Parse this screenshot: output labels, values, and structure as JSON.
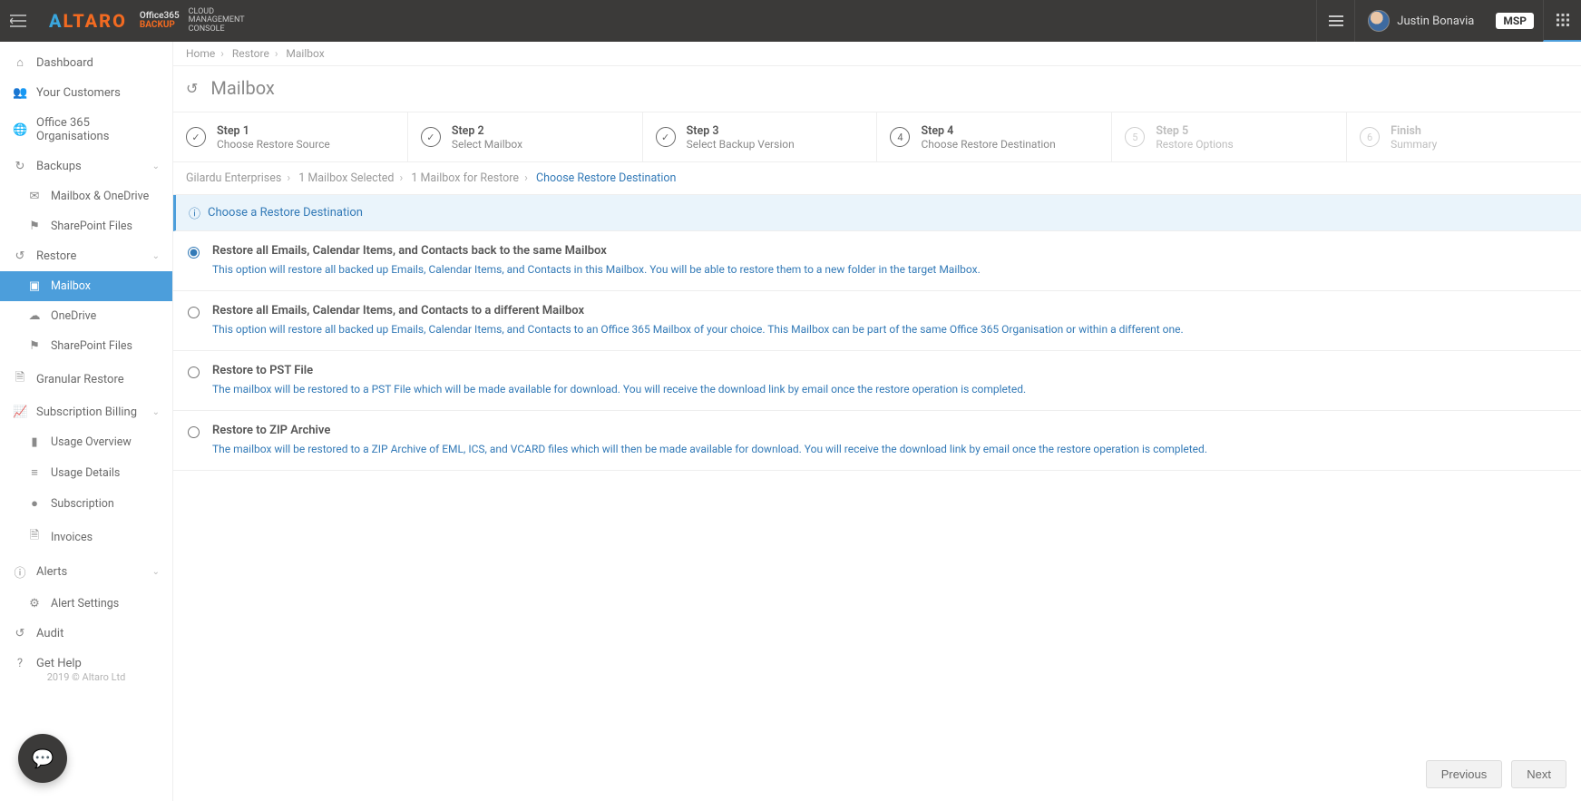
{
  "header": {
    "brand_primary": "ALTARO",
    "brand_office": "Office365",
    "brand_backup": "BACKUP",
    "brand_tag1": "CLOUD",
    "brand_tag2": "MANAGEMENT",
    "brand_tag3": "CONSOLE",
    "user_name": "Justin Bonavia",
    "msp_label": "MSP"
  },
  "sidebar": {
    "items": {
      "dashboard": "Dashboard",
      "your_customers": "Your Customers",
      "office365": "Office 365 Organisations",
      "backups": "Backups",
      "backups_mailbox": "Mailbox & OneDrive",
      "backups_sharepoint": "SharePoint Files",
      "restore": "Restore",
      "restore_mailbox": "Mailbox",
      "restore_onedrive": "OneDrive",
      "restore_sharepoint": "SharePoint Files",
      "granular_restore": "Granular Restore",
      "billing": "Subscription Billing",
      "billing_overview": "Usage Overview",
      "billing_details": "Usage Details",
      "billing_subscription": "Subscription",
      "billing_invoices": "Invoices",
      "alerts": "Alerts",
      "alert_settings": "Alert Settings",
      "audit": "Audit",
      "get_help": "Get Help"
    },
    "footer": "2019  © Altaro Ltd"
  },
  "breadcrumbs": {
    "home": "Home",
    "restore": "Restore",
    "mailbox": "Mailbox"
  },
  "page": {
    "title": "Mailbox"
  },
  "steps": [
    {
      "title": "Step 1",
      "desc": "Choose Restore Source",
      "state": "done"
    },
    {
      "title": "Step 2",
      "desc": "Select Mailbox",
      "state": "done"
    },
    {
      "title": "Step 3",
      "desc": "Select Backup Version",
      "state": "done"
    },
    {
      "title": "Step 4",
      "desc": "Choose Restore Destination",
      "state": "active",
      "num": "4"
    },
    {
      "title": "Step 5",
      "desc": "Restore Options",
      "state": "disabled",
      "num": "5"
    },
    {
      "title": "Finish",
      "desc": "Summary",
      "state": "disabled",
      "num": "6"
    }
  ],
  "wizard_crumbs": {
    "c1": "Gilardu Enterprises",
    "c2": "1 Mailbox Selected",
    "c3": "1 Mailbox for Restore",
    "c4": "Choose Restore Destination"
  },
  "notice": "Choose a Restore Destination",
  "options": [
    {
      "title": "Restore all Emails, Calendar Items, and Contacts back to the same Mailbox",
      "desc": "This option will restore all backed up Emails, Calendar Items, and Contacts in this Mailbox. You will be able to restore them to a new folder in the target Mailbox.",
      "selected": true
    },
    {
      "title": "Restore all Emails, Calendar Items, and Contacts to a different Mailbox",
      "desc": "This option will restore all backed up Emails, Calendar Items, and Contacts to an Office 365 Mailbox of your choice. This Mailbox can be part of the same Office 365 Organisation or within a different one.",
      "selected": false
    },
    {
      "title": "Restore to PST File",
      "desc": "The mailbox will be restored to a PST File which will be made available for download. You will receive the download link by email once the restore operation is completed.",
      "selected": false
    },
    {
      "title": "Restore to ZIP Archive",
      "desc": "The mailbox will be restored to a ZIP Archive of EML, ICS, and VCARD files which will then be made available for download. You will receive the download link by email once the restore operation is completed.",
      "selected": false
    }
  ],
  "footer_buttons": {
    "prev": "Previous",
    "next": "Next"
  }
}
